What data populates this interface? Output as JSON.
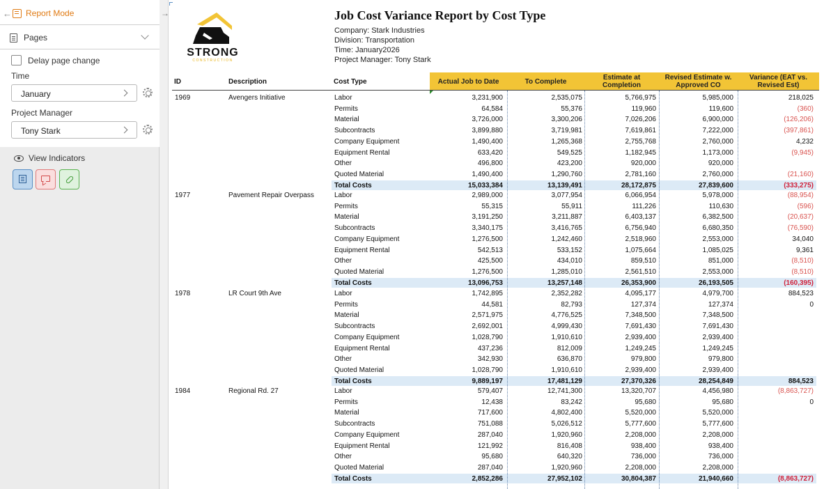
{
  "sidebar": {
    "report_mode": "Report Mode",
    "pages": "Pages",
    "delay_label": "Delay page change",
    "time_label": "Time",
    "time_value": "January",
    "pm_label": "Project Manager",
    "pm_value": "Tony Stark",
    "view_indicators": "View Indicators"
  },
  "logo": {
    "word": "STRONG",
    "sub": "CONSTRUCTION",
    "colors": {
      "accent": "#f2c436",
      "dark": "#111111"
    }
  },
  "report": {
    "title": "Job Cost Variance Report by Cost Type",
    "company": "Company: Stark Industries",
    "division": "Division: Transportation",
    "time": "Time: January2026",
    "manager": "Project Manager: Tony Stark",
    "columns": {
      "id": "ID",
      "description": "Description",
      "cost_type": "Cost Type",
      "actual": "Actual Job to Date",
      "to_complete": "To Complete",
      "estimate": "Estimate at Completion",
      "revised": "Revised Estimate w. Approved CO",
      "variance": "Variance (EAT vs. Revised Est)"
    },
    "header_color": "#f2c436",
    "negative_color": "#d9534f",
    "total_row_color": "#dceaf6",
    "projects": [
      {
        "id": "1969",
        "description": "Avengers Initiative",
        "rows": [
          [
            "Labor",
            "3,231,900",
            "2,535,075",
            "5,766,975",
            "5,985,000",
            "218,025"
          ],
          [
            "Permits",
            "64,584",
            "55,376",
            "119,960",
            "119,600",
            "(360)"
          ],
          [
            "Material",
            "3,726,000",
            "3,300,206",
            "7,026,206",
            "6,900,000",
            "(126,206)"
          ],
          [
            "Subcontracts",
            "3,899,880",
            "3,719,981",
            "7,619,861",
            "7,222,000",
            "(397,861)"
          ],
          [
            "Company Equipment",
            "1,490,400",
            "1,265,368",
            "2,755,768",
            "2,760,000",
            "4,232"
          ],
          [
            "Equipment Rental",
            "633,420",
            "549,525",
            "1,182,945",
            "1,173,000",
            "(9,945)"
          ],
          [
            "Other",
            "496,800",
            "423,200",
            "920,000",
            "920,000",
            ""
          ],
          [
            "Quoted Material",
            "1,490,400",
            "1,290,760",
            "2,781,160",
            "2,760,000",
            "(21,160)"
          ]
        ],
        "total": [
          "Total Costs",
          "15,033,384",
          "13,139,491",
          "28,172,875",
          "27,839,600",
          "(333,275)"
        ]
      },
      {
        "id": "1977",
        "description": "Pavement Repair Overpass",
        "rows": [
          [
            "Labor",
            "2,989,000",
            "3,077,954",
            "6,066,954",
            "5,978,000",
            "(88,954)"
          ],
          [
            "Permits",
            "55,315",
            "55,911",
            "111,226",
            "110,630",
            "(596)"
          ],
          [
            "Material",
            "3,191,250",
            "3,211,887",
            "6,403,137",
            "6,382,500",
            "(20,637)"
          ],
          [
            "Subcontracts",
            "3,340,175",
            "3,416,765",
            "6,756,940",
            "6,680,350",
            "(76,590)"
          ],
          [
            "Company Equipment",
            "1,276,500",
            "1,242,460",
            "2,518,960",
            "2,553,000",
            "34,040"
          ],
          [
            "Equipment Rental",
            "542,513",
            "533,152",
            "1,075,664",
            "1,085,025",
            "9,361"
          ],
          [
            "Other",
            "425,500",
            "434,010",
            "859,510",
            "851,000",
            "(8,510)"
          ],
          [
            "Quoted Material",
            "1,276,500",
            "1,285,010",
            "2,561,510",
            "2,553,000",
            "(8,510)"
          ]
        ],
        "total": [
          "Total Costs",
          "13,096,753",
          "13,257,148",
          "26,353,900",
          "26,193,505",
          "(160,395)"
        ]
      },
      {
        "id": "1978",
        "description": "LR Court 9th Ave",
        "rows": [
          [
            "Labor",
            "1,742,895",
            "2,352,282",
            "4,095,177",
            "4,979,700",
            "884,523"
          ],
          [
            "Permits",
            "44,581",
            "82,793",
            "127,374",
            "127,374",
            "0"
          ],
          [
            "Material",
            "2,571,975",
            "4,776,525",
            "7,348,500",
            "7,348,500",
            ""
          ],
          [
            "Subcontracts",
            "2,692,001",
            "4,999,430",
            "7,691,430",
            "7,691,430",
            ""
          ],
          [
            "Company Equipment",
            "1,028,790",
            "1,910,610",
            "2,939,400",
            "2,939,400",
            ""
          ],
          [
            "Equipment Rental",
            "437,236",
            "812,009",
            "1,249,245",
            "1,249,245",
            ""
          ],
          [
            "Other",
            "342,930",
            "636,870",
            "979,800",
            "979,800",
            ""
          ],
          [
            "Quoted Material",
            "1,028,790",
            "1,910,610",
            "2,939,400",
            "2,939,400",
            ""
          ]
        ],
        "total": [
          "Total Costs",
          "9,889,197",
          "17,481,129",
          "27,370,326",
          "28,254,849",
          "884,523"
        ]
      },
      {
        "id": "1984",
        "description": "Regional Rd. 27",
        "rows": [
          [
            "Labor",
            "579,407",
            "12,741,300",
            "13,320,707",
            "4,456,980",
            "(8,863,727)"
          ],
          [
            "Permits",
            "12,438",
            "83,242",
            "95,680",
            "95,680",
            "0"
          ],
          [
            "Material",
            "717,600",
            "4,802,400",
            "5,520,000",
            "5,520,000",
            ""
          ],
          [
            "Subcontracts",
            "751,088",
            "5,026,512",
            "5,777,600",
            "5,777,600",
            ""
          ],
          [
            "Company Equipment",
            "287,040",
            "1,920,960",
            "2,208,000",
            "2,208,000",
            ""
          ],
          [
            "Equipment Rental",
            "121,992",
            "816,408",
            "938,400",
            "938,400",
            ""
          ],
          [
            "Other",
            "95,680",
            "640,320",
            "736,000",
            "736,000",
            ""
          ],
          [
            "Quoted Material",
            "287,040",
            "1,920,960",
            "2,208,000",
            "2,208,000",
            ""
          ]
        ],
        "total": [
          "Total Costs",
          "2,852,286",
          "27,952,102",
          "30,804,387",
          "21,940,660",
          "(8,863,727)"
        ]
      }
    ]
  }
}
